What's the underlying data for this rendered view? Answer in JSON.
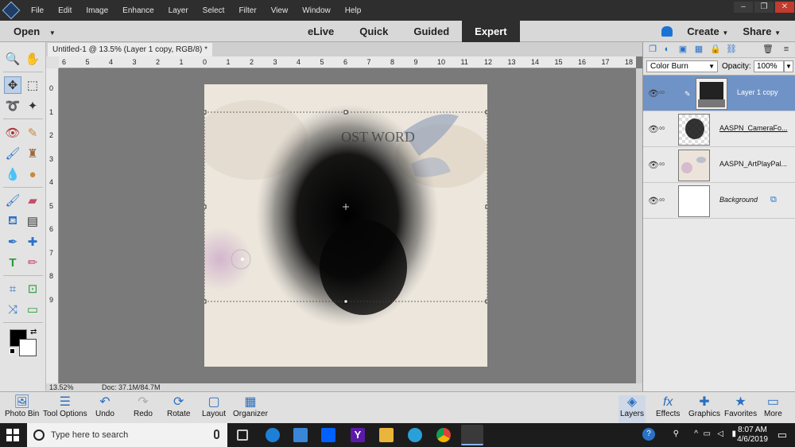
{
  "menubar": {
    "items": [
      "File",
      "Edit",
      "Image",
      "Enhance",
      "Layer",
      "Select",
      "Filter",
      "View",
      "Window",
      "Help"
    ],
    "window_buttons": [
      "–",
      "❐",
      "✕"
    ]
  },
  "modebar": {
    "open_label": "Open",
    "modes": [
      "eLive",
      "Quick",
      "Guided",
      "Expert"
    ],
    "active_mode": "Expert",
    "create_label": "Create",
    "share_label": "Share"
  },
  "document": {
    "tab_title": "Untitled-1 @ 13.5% (Layer 1 copy, RGB/8) *",
    "zoom": "13.52%",
    "doc_size": "Doc: 37.1M/84.7M",
    "artwork_text": "OST WORD"
  },
  "rulers": {
    "horizontal": [
      "6",
      "5",
      "4",
      "3",
      "2",
      "1",
      "0",
      "1",
      "2",
      "3",
      "4",
      "5",
      "6",
      "7",
      "8",
      "9",
      "10",
      "11",
      "12",
      "13",
      "14",
      "15",
      "16",
      "17",
      "18"
    ],
    "vertical": [
      "0",
      "1",
      "2",
      "3",
      "4",
      "5",
      "6",
      "7",
      "8",
      "9"
    ]
  },
  "layers_panel": {
    "blend_mode": "Color Burn",
    "opacity_label": "Opacity:",
    "opacity_value": "100%",
    "layers": [
      {
        "name": "Layer 1 copy",
        "active": true
      },
      {
        "name": "AASPN_CameraFo...",
        "active": false
      },
      {
        "name": "AASPN_ArtPlayPal...",
        "active": false
      },
      {
        "name": "Background",
        "active": false
      }
    ]
  },
  "bottombar": {
    "left": [
      "Photo Bin",
      "Tool Options",
      "Undo",
      "Redo",
      "Rotate",
      "Layout",
      "Organizer"
    ],
    "right": [
      "Layers",
      "Effects",
      "Graphics",
      "Favorites",
      "More"
    ]
  },
  "taskbar": {
    "search_placeholder": "Type here to search",
    "time": "8:07 AM",
    "date": "4/6/2019"
  },
  "colors": {
    "accent": "#1a73d4",
    "active_layer": "#6f93c6",
    "canvas_bg": "#7a7a7a"
  }
}
